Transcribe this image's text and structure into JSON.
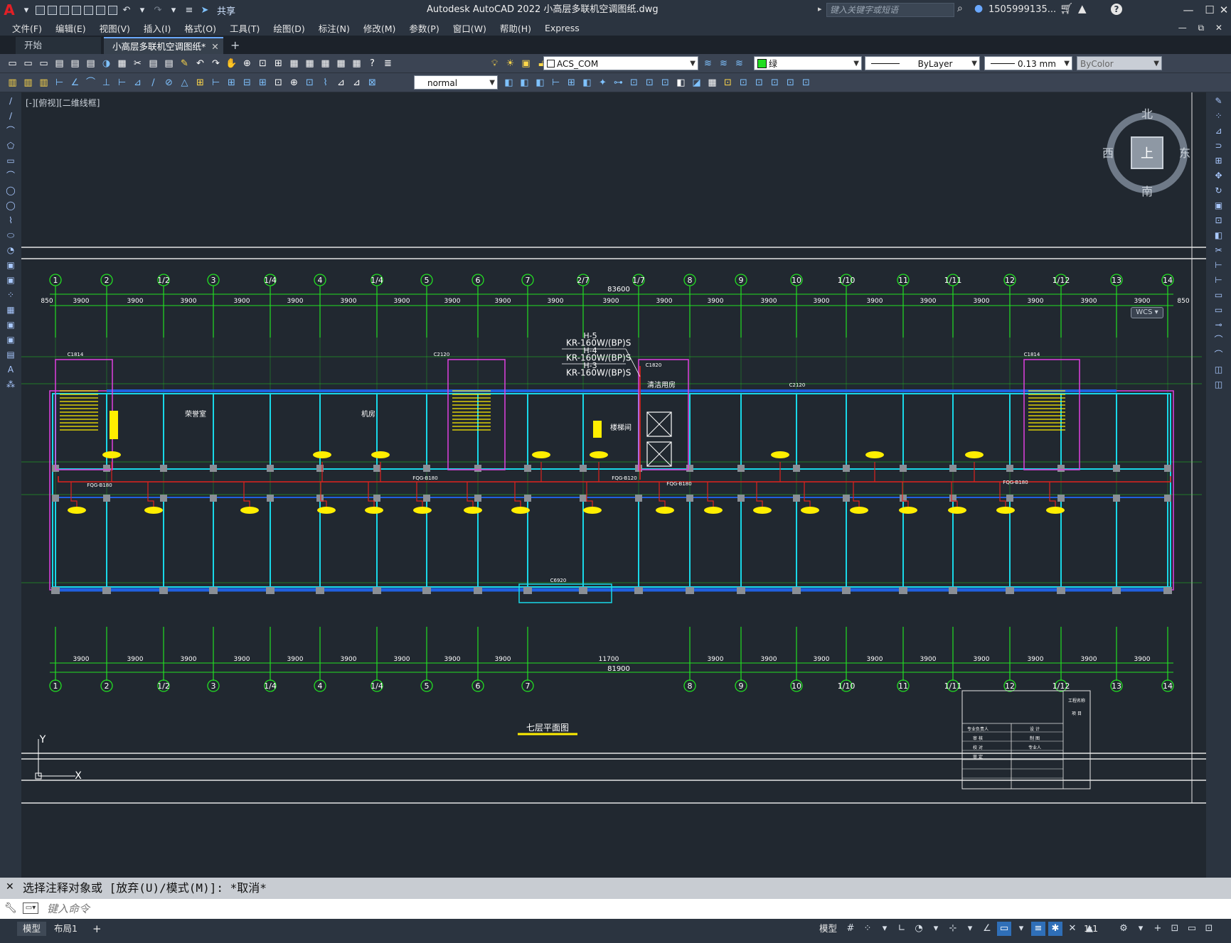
{
  "app": {
    "title": "Autodesk AutoCAD 2022    小高层多联机空调图纸.dwg",
    "share_label": "共享",
    "search_placeholder": "键入关键字或短语",
    "user_name": "1505999135...",
    "minimize": "—",
    "restore": "☐",
    "close": "✕"
  },
  "menu": {
    "items": [
      "文件(F)",
      "编辑(E)",
      "视图(V)",
      "插入(I)",
      "格式(O)",
      "工具(T)",
      "绘图(D)",
      "标注(N)",
      "修改(M)",
      "参数(P)",
      "窗口(W)",
      "帮助(H)",
      "Express"
    ],
    "window_controls": "— ⧉ ✕"
  },
  "tabs": {
    "start": "开始",
    "drawing": "小高层多联机空调图纸*",
    "close": "✕",
    "add": "+"
  },
  "toolbar": {
    "layer": "ACS_COM",
    "color": "绿",
    "linetype": "ByLayer",
    "lineweight": "0.13 mm",
    "plotstyle": "ByColor",
    "textstyle": "normal"
  },
  "viewport": {
    "label": "[-][俯视][二维线框]"
  },
  "viewcube": {
    "north": "北",
    "south": "南",
    "east": "东",
    "west": "西",
    "top": "上",
    "wcs": "WCS"
  },
  "drawing": {
    "grid_top": [
      "1",
      "2",
      "1/2",
      "3",
      "1/4",
      "4",
      "1/4",
      "5",
      "6",
      "7",
      "2/7",
      "1/7",
      "8",
      "9",
      "10",
      "1/10",
      "11",
      "1/11",
      "12",
      "1/12",
      "13",
      "14"
    ],
    "grid_bottom": [
      "1",
      "2",
      "1/2",
      "3",
      "1/4",
      "4",
      "1/4",
      "5",
      "6",
      "7",
      "8",
      "9",
      "10",
      "1/10",
      "11",
      "1/11",
      "12",
      "1/12",
      "13",
      "14"
    ],
    "dim_total_top": "83600",
    "dim_total_bottom": "81900",
    "dim_bay": "3900",
    "dim_edge": "850",
    "dim_mid_bottom": "11700",
    "plan_title": "七层平面图",
    "rooms": [
      "荣誉室",
      "机房",
      "清洁用房",
      "楼梯间"
    ],
    "unit_labels": [
      "H-5",
      "KR-160W/(BP)S",
      "H-4",
      "KR-160W/(BP)S",
      "H-3",
      "KR-160W/(BP)S"
    ],
    "pipe_labels": [
      "FQG-B180",
      "FQG-B180",
      "FQG-B120",
      "FQG-B180",
      "FQG-B180"
    ],
    "window_labels": [
      "C1814",
      "C2120",
      "C1820",
      "C2120",
      "C1814",
      "C6920"
    ],
    "title_block": [
      "工程名称",
      "项 目",
      "专业负责人",
      "设 计",
      "审 核",
      "制 图",
      "校 对",
      "专业人",
      "审 定"
    ],
    "ucs_x": "X",
    "ucs_y": "Y"
  },
  "command": {
    "history": "选择注释对象或 [放弃(U)/模式(M)]: *取消*",
    "placeholder": "键入命令"
  },
  "status": {
    "layout_model": "模型",
    "layout_1": "布局1",
    "add_layout": "+",
    "model_space": "模型",
    "scale": "1:1"
  },
  "colors": {
    "grid_green": "#22e022",
    "wall_cyan": "#18d8e8",
    "pipe_red": "#e0221e",
    "unit_yellow": "#ffee00",
    "outline_magenta": "#e040e0",
    "window_blue": "#2060e0"
  }
}
